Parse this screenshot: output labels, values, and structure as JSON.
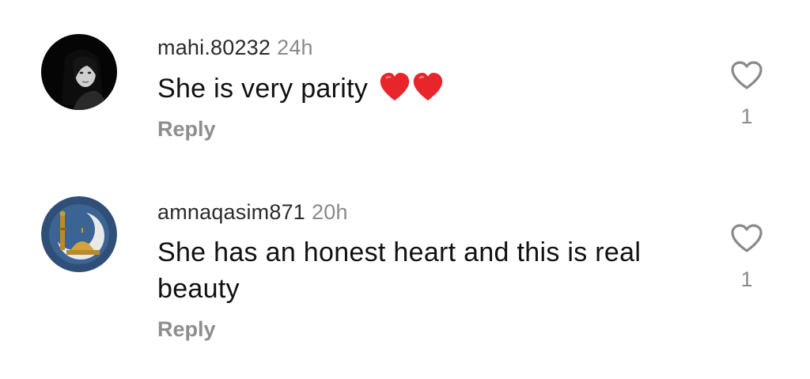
{
  "comments": [
    {
      "username": "mahi.80232",
      "time": "24h",
      "text": "She is very  parity",
      "emoji_icons": [
        "red-heart-icon",
        "red-heart-icon"
      ],
      "reply_label": "Reply",
      "like_count": "1",
      "like_icon": "heart-outline-icon"
    },
    {
      "username": "amnaqasim871",
      "time": "20h",
      "text": "She has an honest heart and this is real beauty",
      "reply_label": "Reply",
      "like_count": "1",
      "like_icon": "heart-outline-icon"
    }
  ],
  "colors": {
    "username": "#2b2b2b",
    "meta": "#8a8a8a",
    "reply": "#8e8e8e",
    "heart_emoji": "#e8252b",
    "avatar2_bg": "#2f4f78"
  }
}
